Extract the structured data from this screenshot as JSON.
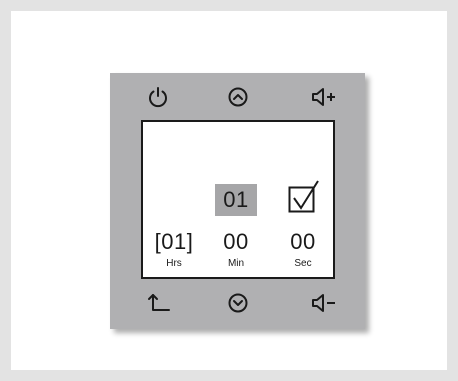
{
  "timer": {
    "selected_value": "01",
    "hours_value": "[01]",
    "minutes_value": "00",
    "seconds_value": "00",
    "hours_label": "Hrs",
    "minutes_label": "Min",
    "seconds_label": "Sec",
    "confirm_checked": true
  },
  "buttons": {
    "top": [
      "power-icon",
      "chevron-up-icon",
      "volume-up-icon"
    ],
    "bottom": [
      "back-icon",
      "chevron-down-icon",
      "volume-down-icon"
    ]
  },
  "colors": {
    "frame": "#e3e3e3",
    "panel": "#b0b0b2",
    "screen": "#ffffff",
    "selection": "#a6a6a8",
    "ink": "#1a1a1a"
  }
}
